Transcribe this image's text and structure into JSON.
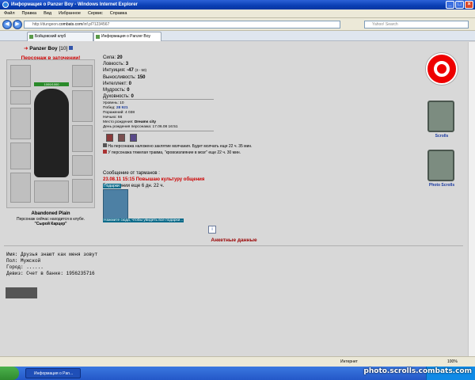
{
  "window": {
    "title": "Информация о Panzer Boy - Windows Internet Explorer"
  },
  "menu": [
    "Файл",
    "Правка",
    "Вид",
    "Избранное",
    "Сервис",
    "Справка"
  ],
  "address": {
    "prefix": "http://dungeon.",
    "domain": "combats.com",
    "suffix": "/inf.pl?1234567"
  },
  "search": {
    "placeholder": "Yahoo! Search"
  },
  "tabs": [
    "Бойцовский клуб",
    "Информация о Panzer Boy"
  ],
  "character": {
    "name": "Panzer Boy",
    "level": "[10]",
    "status": "Персонаж в заточении!",
    "hp": "1000/1000"
  },
  "stats": [
    {
      "label": "Сила:",
      "value": "20"
    },
    {
      "label": "Ловкость:",
      "value": "3"
    },
    {
      "label": "Интуиция:",
      "value": "-47",
      "extra": "(3 - 50)"
    },
    {
      "label": "Выносливость:",
      "value": "150"
    },
    {
      "label": "Интеллект:",
      "value": "0"
    },
    {
      "label": "Мудрость:",
      "value": "0"
    },
    {
      "label": "Духовность:",
      "value": "0"
    }
  ],
  "info": [
    {
      "label": "Уровень:",
      "value": "10"
    },
    {
      "label": "Побед:",
      "value": "28 921"
    },
    {
      "label": "Поражений:",
      "value": "4 038"
    },
    {
      "label": "Ничьих:",
      "value": "66"
    },
    {
      "label": "Место рождения:",
      "value": "Dreams city"
    },
    {
      "label": "День рождения персонажа:",
      "value": "17.06.08 16:51"
    }
  ],
  "effects": [
    {
      "text": "На персонажа наложено заклятие молчания. Будет молчать еще 22 ч. 35 мин."
    },
    {
      "text": "У персонажа тяжелая травма, \"кровоизлияние в мозг\" еще 22 ч. 30 мин."
    }
  ],
  "message": {
    "header": "Сообщение от тарманов :",
    "red": "23.08.11 15:15 Повышаю культуру общения",
    "footer": "В заточении еще 6 дн. 22 ч."
  },
  "gifts": {
    "caption": "Подарки:",
    "link": "Нажмите сюда, чтобы увидеть все подарки..."
  },
  "location": {
    "name": "Abandoned Plain",
    "club": "Персонаж сейчас находится в клубе.",
    "room": "\"Сырой Карцер\""
  },
  "profile": {
    "title": "Анкетные данные",
    "lines": [
      "Имя: Друзья знают как меня зовут",
      "Пол: Мужской",
      "Город: ......",
      "Девиз: Счет в банке: 1956235716"
    ]
  },
  "sidebar": {
    "scrolls": "Scrolls",
    "photo": "Photo Scrolls"
  },
  "statusbar": {
    "zone": "Интернет",
    "zoom": "100%"
  },
  "taskbar": {
    "task": "Информация о Pan..."
  },
  "watermark": "photo.scrolls.combats.com"
}
